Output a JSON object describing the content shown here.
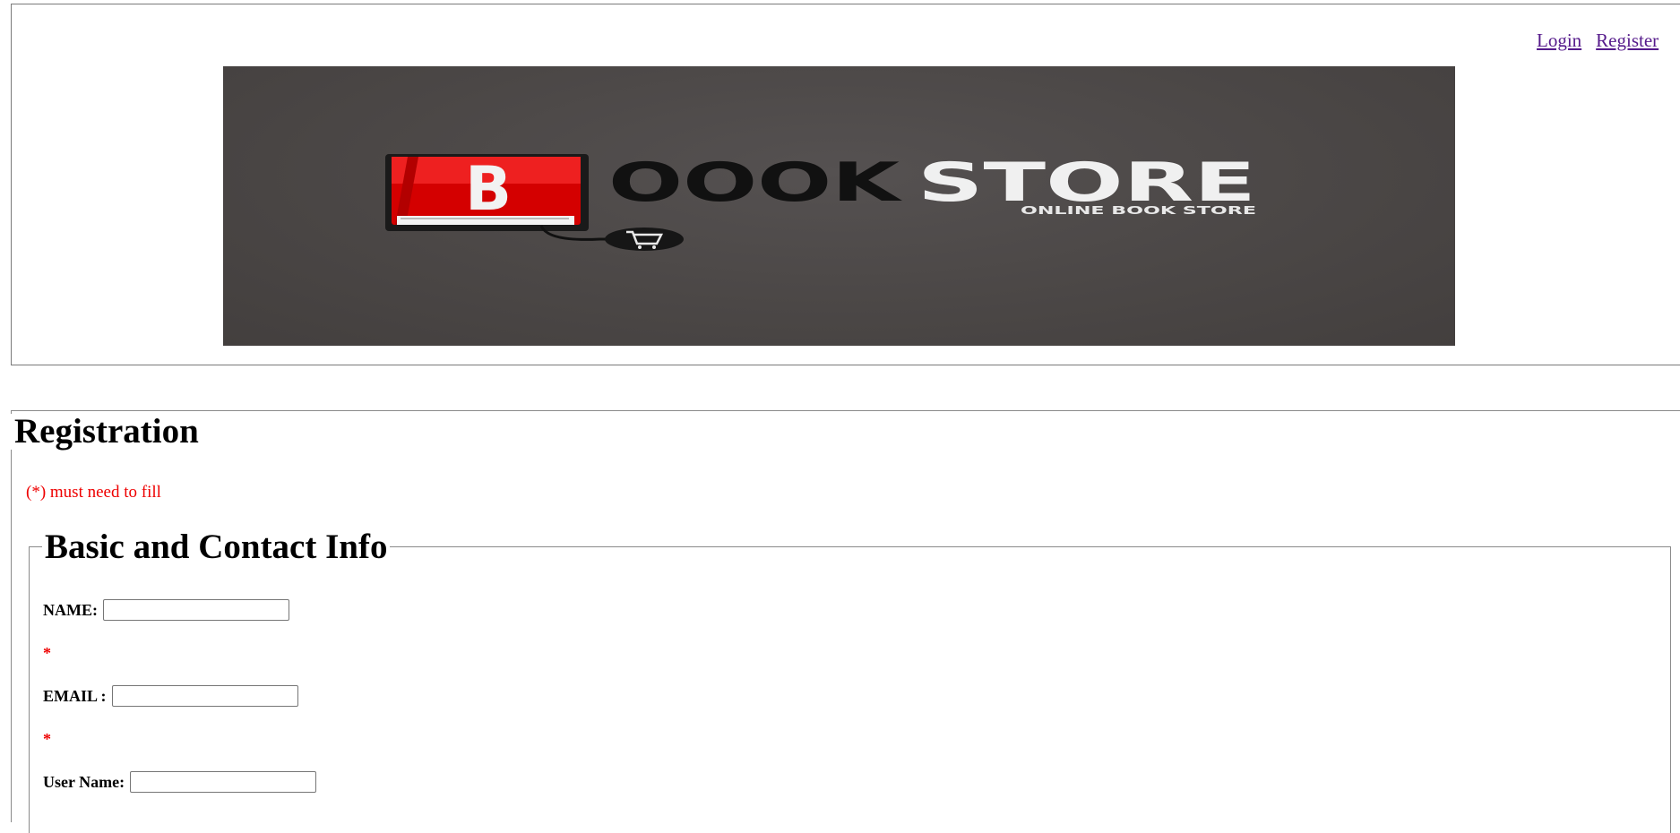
{
  "nav": {
    "login_label": "Login",
    "register_label": "Register"
  },
  "banner": {
    "logo_letter": "B",
    "brand_dark": "OOOK",
    "brand_light": "STORE",
    "tagline": "ONLINE BOOK STORE",
    "logo_icon": "cart-icon",
    "colors": {
      "background": "#4b4746",
      "book_red": "#d40000",
      "text_dark": "#111111",
      "text_light": "#f0f0f0"
    }
  },
  "registration": {
    "title": "Registration",
    "required_note": "(*) must need to fill",
    "section_title": "Basic and Contact Info",
    "fields": [
      {
        "label": "NAME:",
        "value": "",
        "placeholder": "",
        "required_mark": "*"
      },
      {
        "label": "EMAIL :",
        "value": "",
        "placeholder": "",
        "required_mark": "*"
      },
      {
        "label": "User Name:",
        "value": "",
        "placeholder": ""
      }
    ]
  },
  "colors": {
    "link": "#551a8b",
    "required": "#ee0000",
    "border": "#8a8a8a"
  }
}
